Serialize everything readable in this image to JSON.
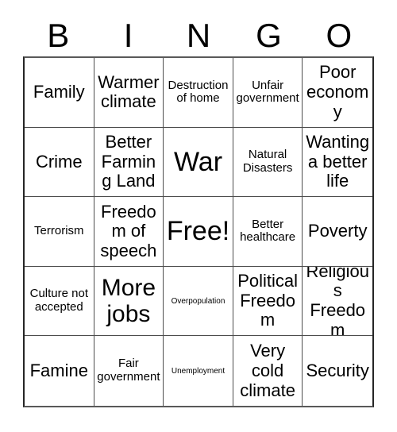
{
  "card": {
    "title": "BINGO Card",
    "header_letters": [
      "B",
      "I",
      "N",
      "G",
      "O"
    ],
    "colors": {
      "background": "#ffffff",
      "text": "#000000",
      "grid_line": "#4d4d4d",
      "grid_outer": "#262626"
    },
    "grid": {
      "columns": 5,
      "rows": 5,
      "cells": [
        {
          "text": "Family",
          "size": "md"
        },
        {
          "text": "Warmer climate",
          "size": "md"
        },
        {
          "text": "Destruction of home",
          "size": "sm"
        },
        {
          "text": "Unfair government",
          "size": "sm"
        },
        {
          "text": "Poor economy",
          "size": "md"
        },
        {
          "text": "Crime",
          "size": "md"
        },
        {
          "text": "Better Farming Land",
          "size": "md"
        },
        {
          "text": "War",
          "size": "xl"
        },
        {
          "text": "Natural Disasters",
          "size": "sm"
        },
        {
          "text": "Wanting a better life",
          "size": "md"
        },
        {
          "text": "Terrorism",
          "size": "sm"
        },
        {
          "text": "Freedom of speech",
          "size": "md"
        },
        {
          "text": "Free!",
          "size": "xl"
        },
        {
          "text": "Better healthcare",
          "size": "sm"
        },
        {
          "text": "Poverty",
          "size": "md"
        },
        {
          "text": "Culture not accepted",
          "size": "sm"
        },
        {
          "text": "More jobs",
          "size": "lg"
        },
        {
          "text": "Overpopulation",
          "size": "xs"
        },
        {
          "text": "Political Freedom",
          "size": "md"
        },
        {
          "text": "Religious Freedom",
          "size": "md"
        },
        {
          "text": "Famine",
          "size": "md"
        },
        {
          "text": "Fair government",
          "size": "sm"
        },
        {
          "text": "Unemployment",
          "size": "xs"
        },
        {
          "text": "Very cold climate",
          "size": "md"
        },
        {
          "text": "Security",
          "size": "md"
        }
      ]
    }
  }
}
